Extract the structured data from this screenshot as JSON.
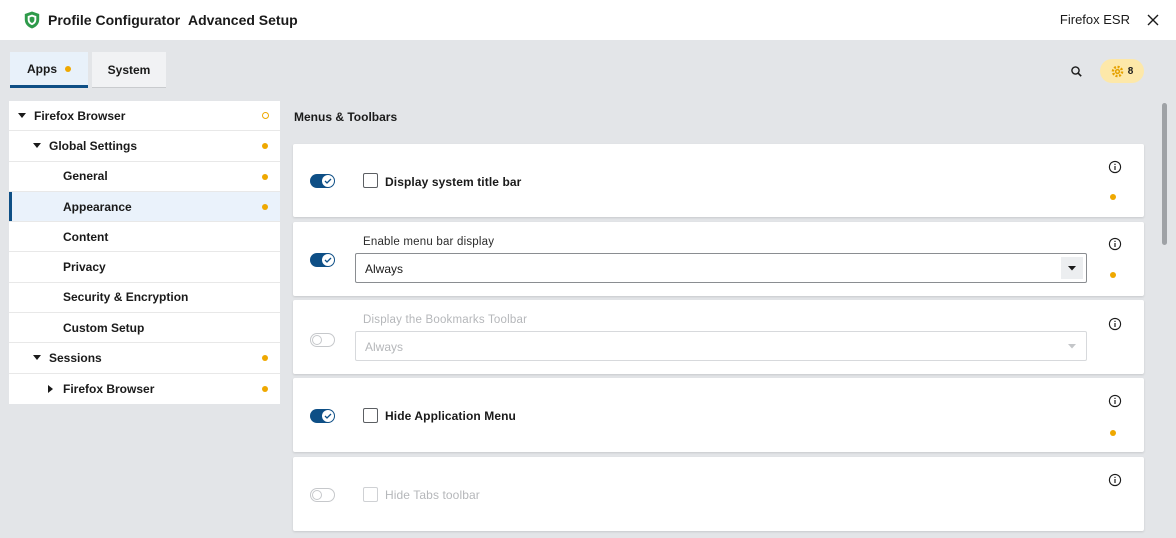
{
  "header": {
    "app_title": "Profile Configurator",
    "subtitle": "Advanced Setup",
    "environment": "Firefox ESR",
    "logo_icon": "shield-icon",
    "close_icon": "close-icon"
  },
  "tabs": [
    {
      "label": "Apps",
      "active": true,
      "modified": true
    },
    {
      "label": "System",
      "active": false,
      "modified": false
    }
  ],
  "toolbar": {
    "search_icon": "search-icon",
    "changes_count": "8",
    "changes_icon": "gear-icon"
  },
  "tree": [
    {
      "label": "Firefox Browser",
      "level": 0,
      "expanded": true,
      "status": "partial"
    },
    {
      "label": "Global Settings",
      "level": 1,
      "expanded": true,
      "status": "modified"
    },
    {
      "label": "General",
      "level": 2,
      "status": "modified"
    },
    {
      "label": "Appearance",
      "level": 2,
      "status": "modified",
      "selected": true
    },
    {
      "label": "Content",
      "level": 2,
      "status": "none"
    },
    {
      "label": "Privacy",
      "level": 2,
      "status": "none"
    },
    {
      "label": "Security & Encryption",
      "level": 2,
      "status": "none"
    },
    {
      "label": "Custom Setup",
      "level": 2,
      "status": "none"
    },
    {
      "label": "Sessions",
      "level": 1,
      "expanded": true,
      "status": "modified"
    },
    {
      "label": "Firefox Browser",
      "level": 2,
      "expanded": false,
      "status": "modified"
    }
  ],
  "section": {
    "title": "Menus & Toolbars"
  },
  "settings": [
    {
      "type": "checkbox",
      "label": "Display system title bar",
      "enabled": true,
      "checked": false,
      "modified": true
    },
    {
      "type": "select",
      "label": "Enable menu bar display",
      "value": "Always",
      "enabled": true,
      "modified": true
    },
    {
      "type": "select",
      "label": "Display the Bookmarks Toolbar",
      "value": "Always",
      "enabled": false,
      "modified": false
    },
    {
      "type": "checkbox",
      "label": "Hide Application Menu",
      "enabled": true,
      "checked": false,
      "modified": true
    },
    {
      "type": "checkbox",
      "label": "Hide Tabs toolbar",
      "enabled": false,
      "checked": false,
      "modified": false
    }
  ],
  "colors": {
    "accent": "#0e4f86",
    "modified": "#efa800",
    "badge_bg": "#fde8a9",
    "logo": "#2e9a4a"
  }
}
